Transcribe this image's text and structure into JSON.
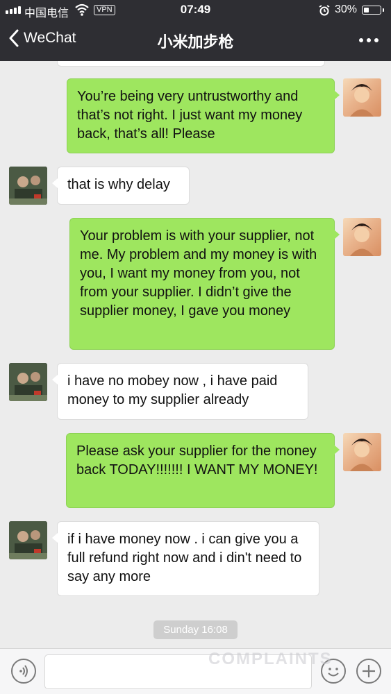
{
  "status_bar": {
    "carrier": "中国电信",
    "vpn": "VPN",
    "time": "07:49",
    "battery": "30%",
    "battery_level": 0.3
  },
  "header": {
    "back_label": "WeChat",
    "title": "小米加步枪"
  },
  "messages": [
    {
      "from": "me",
      "text": "You’re being very untrustworthy and that’s not right. I just want my money back, that’s all! Please"
    },
    {
      "from": "them",
      "text": "that is why delay"
    },
    {
      "from": "me",
      "text": "Your problem is with your supplier, not me. My problem and my money is with you, I want my money from you, not from your supplier. I didn’t give the supplier money, I gave you money"
    },
    {
      "from": "them",
      "text": "i have no mobey now , i have paid money to my supplier already"
    },
    {
      "from": "me",
      "text": "Please ask your supplier for the money back TODAY!!!!!!! I WANT MY MONEY!"
    },
    {
      "from": "them",
      "text": "if i have money now . i can give you a full refund right now and i din't need to say any more"
    }
  ],
  "timestamp": "Sunday 16:08",
  "watermark": "COMPLAINTS",
  "icons": {
    "back": "chevron-left-icon",
    "more": "more-dots-icon",
    "voice": "voice-icon",
    "emoji": "emoji-icon",
    "plus": "plus-icon"
  }
}
